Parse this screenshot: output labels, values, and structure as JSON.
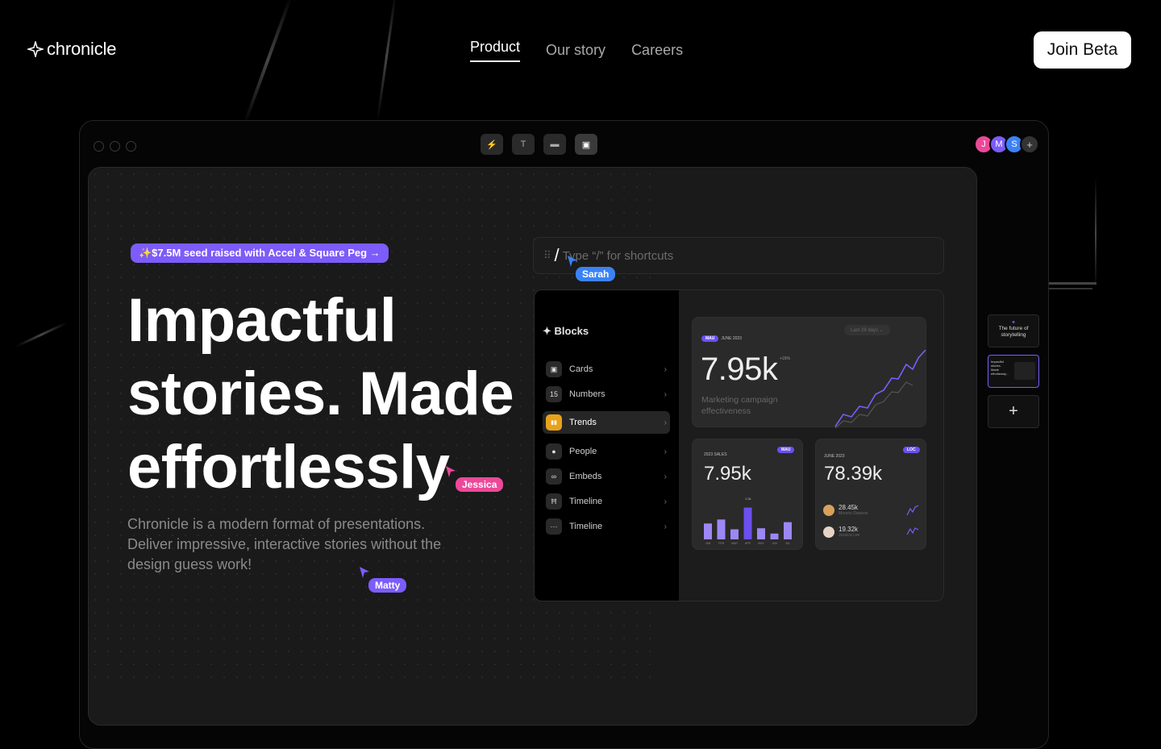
{
  "header": {
    "logo": "chronicle",
    "nav": [
      {
        "label": "Product",
        "active": true
      },
      {
        "label": "Our story",
        "active": false
      },
      {
        "label": "Careers",
        "active": false
      }
    ],
    "cta": "Join Beta"
  },
  "toolbar": {
    "tools": [
      "bolt-icon",
      "text-icon",
      "image-icon",
      "layout-icon"
    ],
    "avatars": [
      {
        "initial": "J",
        "color": "#ec4899"
      },
      {
        "initial": "M",
        "color": "#7c5cfa"
      },
      {
        "initial": "S",
        "color": "#3b82f6"
      }
    ],
    "add_label": "+"
  },
  "hero": {
    "badge": "✨$7.5M seed raised with Accel & Square Peg →",
    "line1": "Impactful",
    "line2": "stories. Made",
    "line3": "effortlessly",
    "subtitle": "Chronicle is a modern format of presentations. Deliver impressive, interactive stories without the design guess work!"
  },
  "cursors": [
    {
      "name": "Sarah",
      "color": "#3b82f6"
    },
    {
      "name": "Jessica",
      "color": "#ec4899"
    },
    {
      "name": "Matty",
      "color": "#7c5cfa"
    }
  ],
  "command": {
    "placeholder": "Type “/” for shortcuts"
  },
  "blocks": {
    "title": "Blocks",
    "items": [
      {
        "label": "Cards",
        "icon": "card-icon",
        "glyph": "▣"
      },
      {
        "label": "Numbers",
        "icon": "numbers-icon",
        "glyph": "15"
      },
      {
        "label": "Trends",
        "icon": "trends-icon",
        "glyph": "▮▮"
      },
      {
        "label": "People",
        "icon": "people-icon",
        "glyph": "●"
      },
      {
        "label": "Embeds",
        "icon": "link-icon",
        "glyph": "∞"
      },
      {
        "label": "Timeline",
        "icon": "timeline-icon",
        "glyph": "Ħ"
      },
      {
        "label": "Timeline",
        "icon": "more-icon",
        "glyph": "···"
      }
    ]
  },
  "cards": {
    "main": {
      "tag": "MAU",
      "date": "JUNE 2023",
      "range": "Last 28 days",
      "value": "7.95k",
      "delta": "+16%",
      "label": "Marketing campaign effectiveness"
    },
    "sales": {
      "title": "2023 SALES",
      "tag": "MAU",
      "value": "7.95k",
      "peak": "1.2k"
    },
    "loc": {
      "date": "JUNE 2023",
      "tag": "LOC",
      "value": "78.39k",
      "people": [
        {
          "value": "28.45k",
          "name": "Moreno Dawson"
        },
        {
          "value": "19.32k",
          "name": "Jessica Lee"
        }
      ]
    }
  },
  "chart_data": {
    "type": "bar",
    "categories": [
      "JAN",
      "FEB",
      "MAR",
      "APR",
      "MAY",
      "JUN",
      "JUL"
    ],
    "values": [
      0.6,
      0.75,
      0.38,
      1.2,
      0.42,
      0.22,
      0.65
    ],
    "ylim": [
      0,
      1.4
    ]
  },
  "thumbs": {
    "first": "The future of storytelling",
    "second": "Impactful stories. Made effortlessly...",
    "add": "+"
  },
  "colors": {
    "accent": "#7c5cfa",
    "pink": "#ec4899",
    "blue": "#3b82f6"
  }
}
